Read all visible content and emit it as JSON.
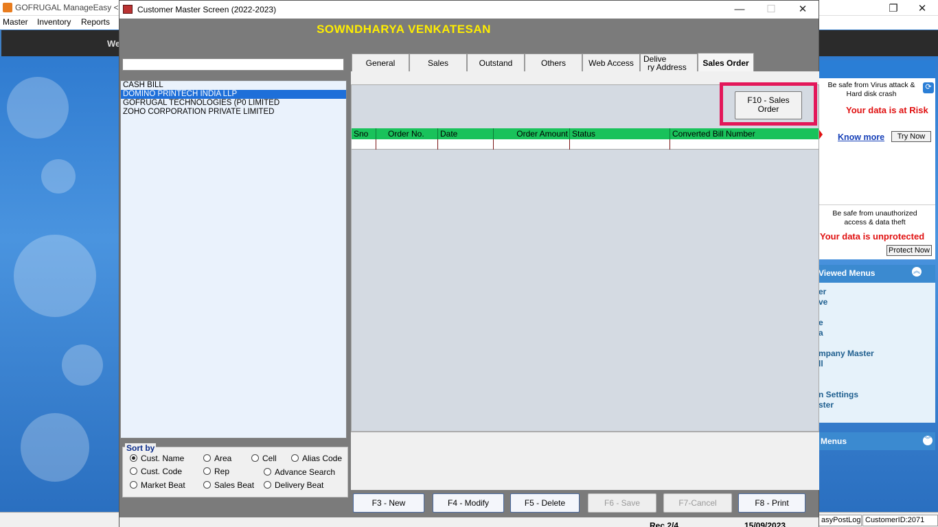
{
  "main": {
    "title": "GOFRUGAL ManageEasy <<",
    "menu": [
      "Master",
      "Inventory",
      "Reports"
    ],
    "welcome": "We",
    "restore_icon": "restore-icon",
    "close_icon": "close-icon"
  },
  "right_panel": {
    "virus_text": "Be safe from Virus attack & Hard disk crash",
    "risk_text": "Your data is at Risk",
    "know_more": "Know more",
    "try_now": "Try Now",
    "unauth_text": "Be safe from unauthorized access & data theft",
    "unprotected_text": "Your data is unprotected",
    "protect_now": "Protect Now",
    "recent_title": "Viewed Menus",
    "recent_items": [
      "er",
      "ve",
      "e",
      "a",
      "mpany Master",
      "ll",
      "n Settings",
      "ster"
    ],
    "menus_title": "Menus",
    "colors": {
      "risk": "#e01010",
      "header": "#3b8ad0"
    }
  },
  "dialog": {
    "title": "Customer Master Screen (2022-2023)",
    "customer_name": "SOWNDHARYA VENKATESAN",
    "search_value": "",
    "customers": [
      {
        "name": "CASH BILL",
        "selected": false
      },
      {
        "name": "DOMINO PRINTECH INDIA LLP",
        "selected": true
      },
      {
        "name": "GOFRUGAL TECHNOLOGIES (P0 LIMITED",
        "selected": false
      },
      {
        "name": "ZOHO CORPORATION PRIVATE LIMITED",
        "selected": false
      }
    ],
    "sort_by": {
      "label": "Sort by",
      "options": [
        "Cust. Name",
        "Area",
        "Cell",
        "Alias Code",
        "Cust. Code",
        "Rep",
        "Advance Search",
        "Market Beat",
        "Sales Beat",
        "Delivery Beat"
      ],
      "selected": "Cust. Name"
    },
    "tabs": [
      "General",
      "Sales",
      "Outstand",
      "Others",
      "Web Access",
      "Delive",
      "ry Address",
      "Sales Order"
    ],
    "active_tab": "Sales Order",
    "f10_button": "F10 - Sales Order",
    "grid": {
      "columns": [
        "Sno",
        "Order No.",
        "Date",
        "Order Amount",
        "Status",
        "Converted Bill Number"
      ],
      "rows": []
    },
    "buttons": {
      "new": "F3 - New",
      "modify": "F4 - Modify",
      "delete": "F5 - Delete",
      "save": "F6 - Save",
      "cancel": "F7-Cancel",
      "print": "F8 - Print"
    },
    "status_fragments": [
      "Rec 2/4",
      "15/09/2023"
    ]
  },
  "taskbar": {
    "post_log": "asyPostLog",
    "customer_id": "CustomerID:2071"
  }
}
